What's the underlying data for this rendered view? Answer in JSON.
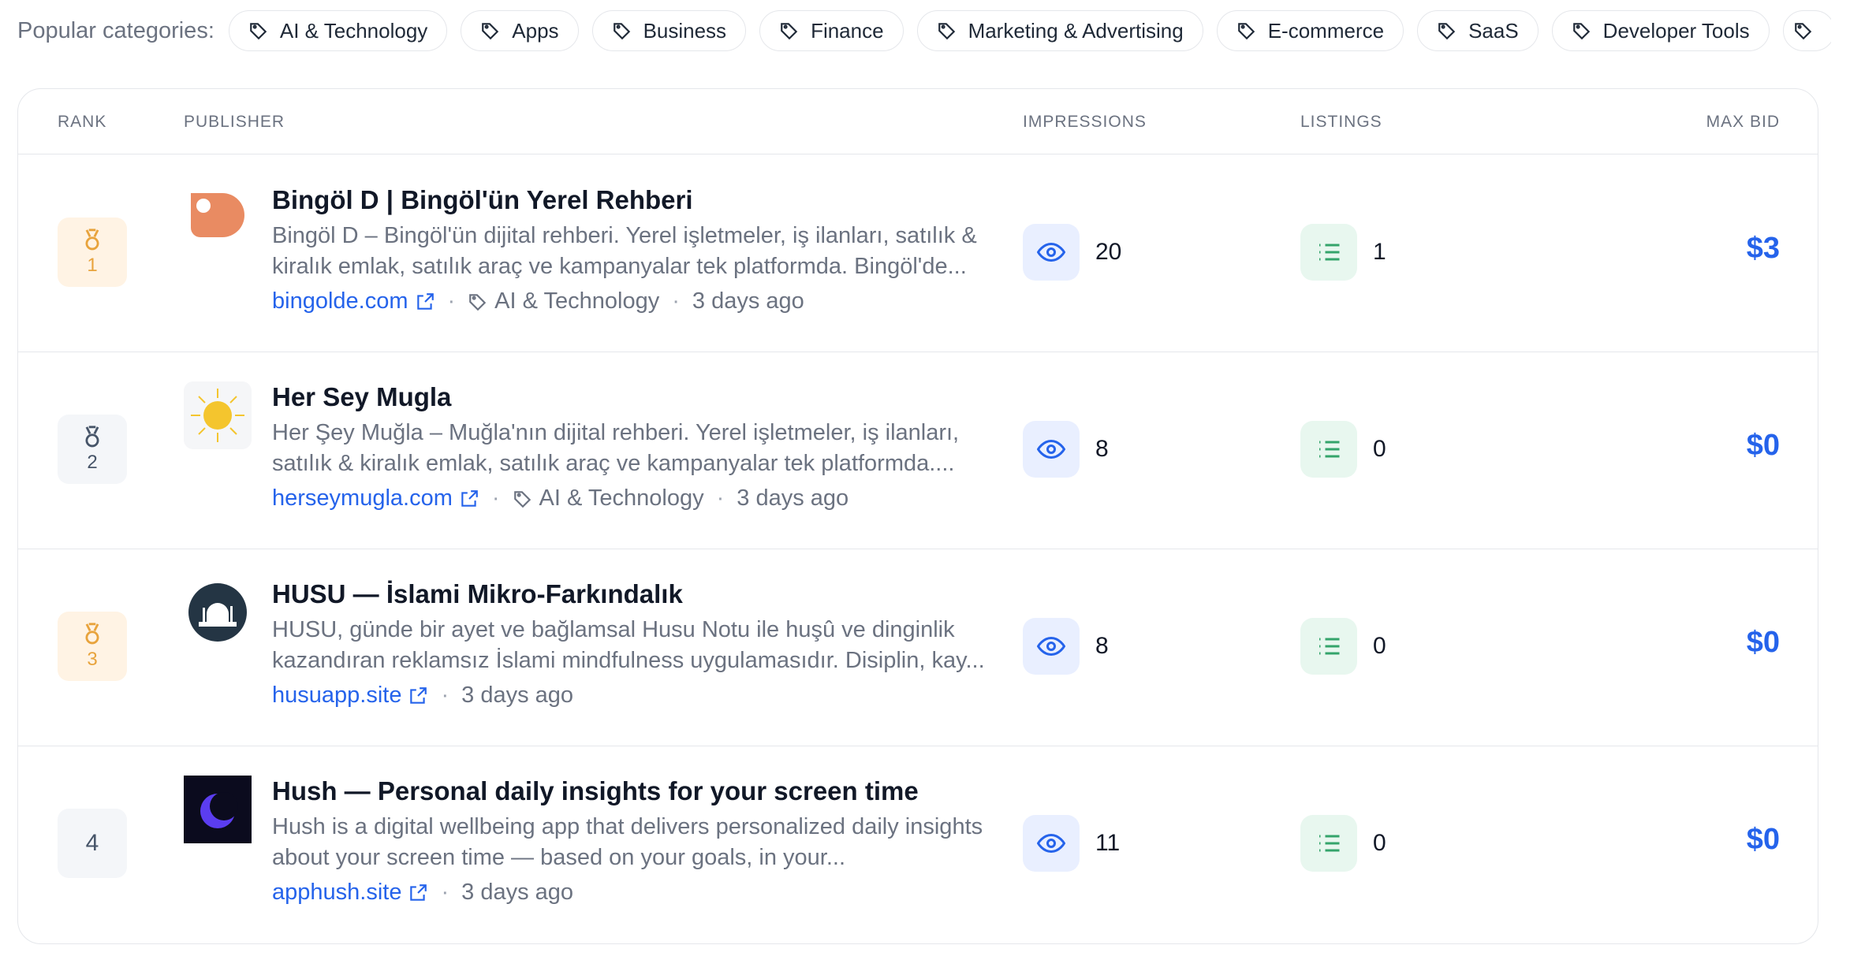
{
  "categories": {
    "label": "Popular categories:",
    "items": [
      "AI & Technology",
      "Apps",
      "Business",
      "Finance",
      "Marketing & Advertising",
      "E-commerce",
      "SaaS",
      "Developer Tools"
    ]
  },
  "table": {
    "headers": {
      "rank": "RANK",
      "publisher": "PUBLISHER",
      "impressions": "IMPRESSIONS",
      "listings": "LISTINGS",
      "max_bid": "MAX BID"
    },
    "rows": [
      {
        "rank": "1",
        "title": "Bingöl D | Bingöl'ün Yerel Rehberi",
        "description": "Bingöl D – Bingöl'ün dijital rehberi. Yerel işletmeler, iş ilanları, satılık & kiralık emlak, satılık araç ve kampanyalar tek platformda. Bingöl'de...",
        "url": "bingolde.com",
        "category": "AI & Technology",
        "time": "3 days ago",
        "impressions": "20",
        "listings": "1",
        "max_bid": "$3"
      },
      {
        "rank": "2",
        "title": "Her Sey Mugla",
        "description": "Her Şey Muğla – Muğla'nın dijital rehberi. Yerel işletmeler, iş ilanları, satılık & kiralık emlak, satılık araç ve kampanyalar tek platformda....",
        "url": "herseymugla.com",
        "category": "AI & Technology",
        "time": "3 days ago",
        "impressions": "8",
        "listings": "0",
        "max_bid": "$0"
      },
      {
        "rank": "3",
        "title": "HUSU — İslami Mikro-Farkındalık",
        "description": "HUSU, günde bir ayet ve bağlamsal Husu Notu ile huşû ve dinginlik kazandıran reklamsız İslami mindfulness uygulamasıdır. Disiplin, kay...",
        "url": "husuapp.site",
        "time": "3 days ago",
        "impressions": "8",
        "listings": "0",
        "max_bid": "$0"
      },
      {
        "rank": "4",
        "title": "Hush — Personal daily insights for your screen time",
        "description": "Hush is a digital wellbeing app that delivers personalized daily insights about your screen time — based on your goals, in your...",
        "url": "apphush.site",
        "time": "3 days ago",
        "impressions": "11",
        "listings": "0",
        "max_bid": "$0"
      }
    ]
  },
  "colors": {
    "accent": "#2563eb",
    "gold": "#e8a33c",
    "listing_green": "#34a46b"
  },
  "icons": [
    "tag-icon",
    "medal-icon",
    "external-link-icon",
    "eye-icon",
    "list-icon"
  ]
}
